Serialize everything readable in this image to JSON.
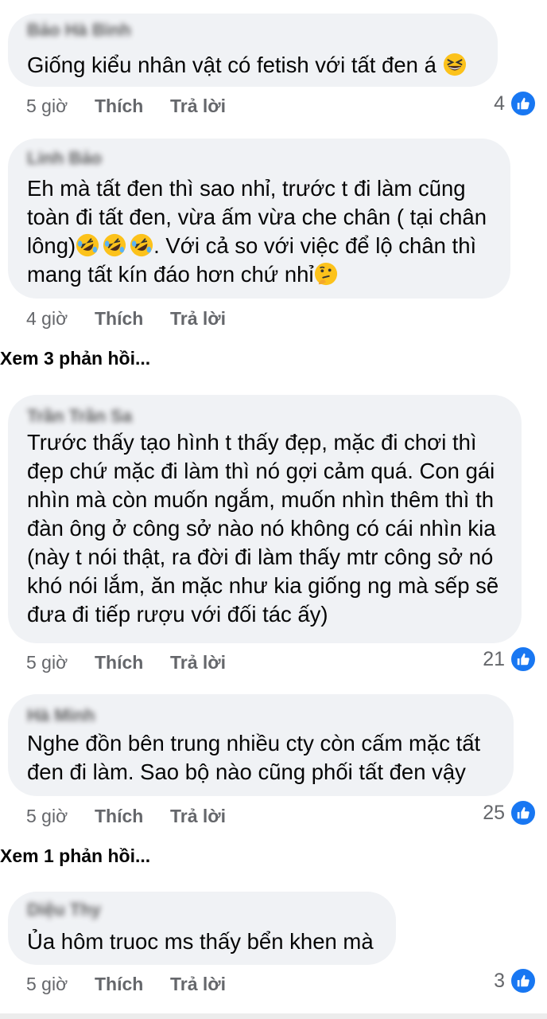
{
  "comments": [
    {
      "author": "Bảo Hà Bình",
      "text_lines": [
        "Giống kiểu nhân vật có fetish với tất đen á"
      ],
      "emoji_after": "grinning-squinting-face",
      "time": "5 giờ",
      "like_label": "Thích",
      "reply_label": "Trả lời",
      "reaction_count": "4"
    },
    {
      "author": "Linh Bảo",
      "text_lines": [
        "Eh mà tất đen thì sao nhỉ, trước t đi làm cũng",
        "toàn đi tất đen, vừa ấm vừa che chân ( tại chân",
        "lông)",
        ". Với cả so với việc để lộ chân thì",
        "mang tất kín đáo hơn chứ nhỉ"
      ],
      "emoji_laugh": "rolling-on-floor-laughing",
      "emoji_think": "thinking-face",
      "time": "4 giờ",
      "like_label": "Thích",
      "reply_label": "Trả lời",
      "reaction_count": ""
    },
    {
      "author": "Trần Trần Sa",
      "text_lines": [
        "Trước thấy tạo hình t thấy đẹp, mặc đi chơi thì",
        "đẹp chứ mặc đi làm thì nó gợi cảm quá. Con gái",
        "nhìn mà còn muốn ngắm, muốn nhìn thêm thì th",
        "đàn ông ở công sở nào nó không có cái nhìn kia",
        "(này t nói thật, ra đời đi làm thấy mtr công sở nó",
        "khó nói lắm, ăn mặc như kia giống ng mà sếp sẽ",
        "đưa đi tiếp rượu với đối tác ấy)"
      ],
      "time": "5 giờ",
      "like_label": "Thích",
      "reply_label": "Trả lời",
      "reaction_count": "21"
    },
    {
      "author": "Hà Minh",
      "text_lines": [
        "Nghe đồn bên trung nhiều cty còn cấm mặc tất",
        "đen đi làm. Sao bộ nào cũng phối tất đen vậy"
      ],
      "time": "5 giờ",
      "like_label": "Thích",
      "reply_label": "Trả lời",
      "reaction_count": "25"
    },
    {
      "author": "Diệu Thy",
      "text_lines": [
        "Ủa hôm truoc ms thấy bển khen mà"
      ],
      "time": "5 giờ",
      "like_label": "Thích",
      "reply_label": "Trả lời",
      "reaction_count": "3"
    }
  ],
  "view_replies": [
    "Xem 3 phản hồi...",
    "Xem 1 phản hồi..."
  ],
  "colors": {
    "bubble": "#f0f2f5",
    "meta_text": "#65676b",
    "like_blue": "#1877f2",
    "text": "#050505"
  },
  "icons": {
    "reaction": "like-thumbs-up-icon"
  }
}
